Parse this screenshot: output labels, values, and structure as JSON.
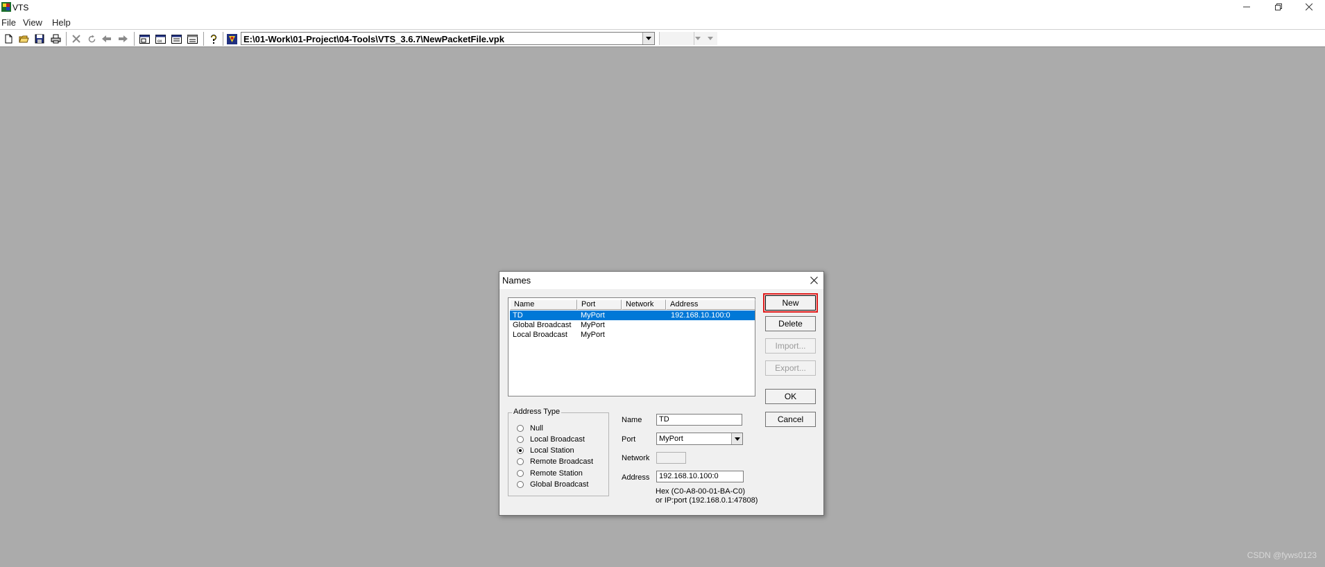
{
  "window": {
    "title": "VTS",
    "controls": {
      "minimize": "minimize-icon",
      "restore": "restore-icon",
      "close": "close-icon"
    }
  },
  "menu": [
    "File",
    "View",
    "Help"
  ],
  "toolbar": {
    "icons": [
      "new-file-icon",
      "open-folder-icon",
      "save-icon",
      "print-icon",
      "delete-icon",
      "refresh-icon",
      "back-icon",
      "forward-icon",
      "window1-icon",
      "window2-icon",
      "window3-icon",
      "window4-icon",
      "help-icon",
      "vts-logo-icon"
    ],
    "path": "E:\\01-Work\\01-Project\\04-Tools\\VTS_3.6.7\\NewPacketFile.vpk"
  },
  "dialog": {
    "title": "Names",
    "list": {
      "columns": [
        "Name",
        "Port",
        "Network",
        "Address"
      ],
      "rows": [
        {
          "name": "TD",
          "port": "MyPort",
          "network": "",
          "address": "192.168.10.100:0",
          "selected": true
        },
        {
          "name": "Global Broadcast",
          "port": "MyPort",
          "network": "",
          "address": "",
          "selected": false
        },
        {
          "name": "Local Broadcast",
          "port": "MyPort",
          "network": "",
          "address": "",
          "selected": false
        }
      ]
    },
    "buttons": {
      "new": "New",
      "delete": "Delete",
      "import": "Import...",
      "export": "Export...",
      "ok": "OK",
      "cancel": "Cancel"
    },
    "address_type": {
      "label": "Address Type",
      "options": [
        "Null",
        "Local Broadcast",
        "Local Station",
        "Remote Broadcast",
        "Remote Station",
        "Global Broadcast"
      ],
      "selected": "Local Station"
    },
    "fields": {
      "name_label": "Name",
      "name_value": "TD",
      "port_label": "Port",
      "port_value": "MyPort",
      "network_label": "Network",
      "network_value": "",
      "address_label": "Address",
      "address_value": "192.168.10.100:0",
      "hint_hex": "Hex  (C0-A8-00-01-BA-C0)",
      "hint_ip": "or IP:port (192.168.0.1:47808)"
    }
  },
  "watermark": "CSDN @fyws0123",
  "colors": {
    "desktop": "#ababab",
    "selection": "#0078d7",
    "focus_highlight": "#e01b1b"
  }
}
